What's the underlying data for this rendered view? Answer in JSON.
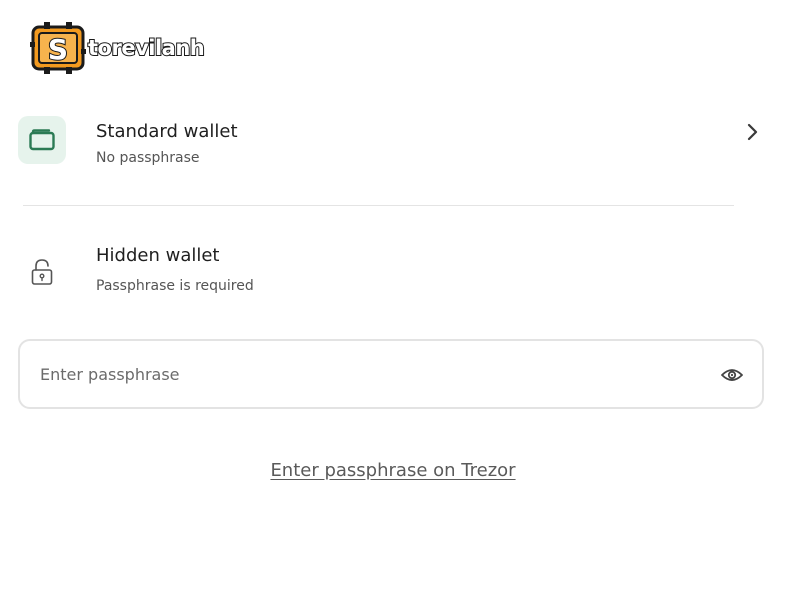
{
  "brand": {
    "logo_text": "torevilanh",
    "logo_letter": "S",
    "logo_icon": "storevilanh-logo-icon",
    "accent_orange": "#f39a1f",
    "accent_green": "#2b7a54"
  },
  "wallets": {
    "standard": {
      "title": "Standard wallet",
      "subtitle": "No passphrase",
      "icon": "wallet-icon",
      "action_icon": "chevron-right-icon"
    },
    "hidden": {
      "title": "Hidden wallet",
      "subtitle": "Passphrase is required",
      "icon": "lock-icon"
    }
  },
  "passphrase": {
    "placeholder": "Enter passphrase",
    "value": "",
    "toggle_icon": "eye-icon"
  },
  "links": {
    "enter_on_device": "Enter passphrase on Trezor"
  }
}
